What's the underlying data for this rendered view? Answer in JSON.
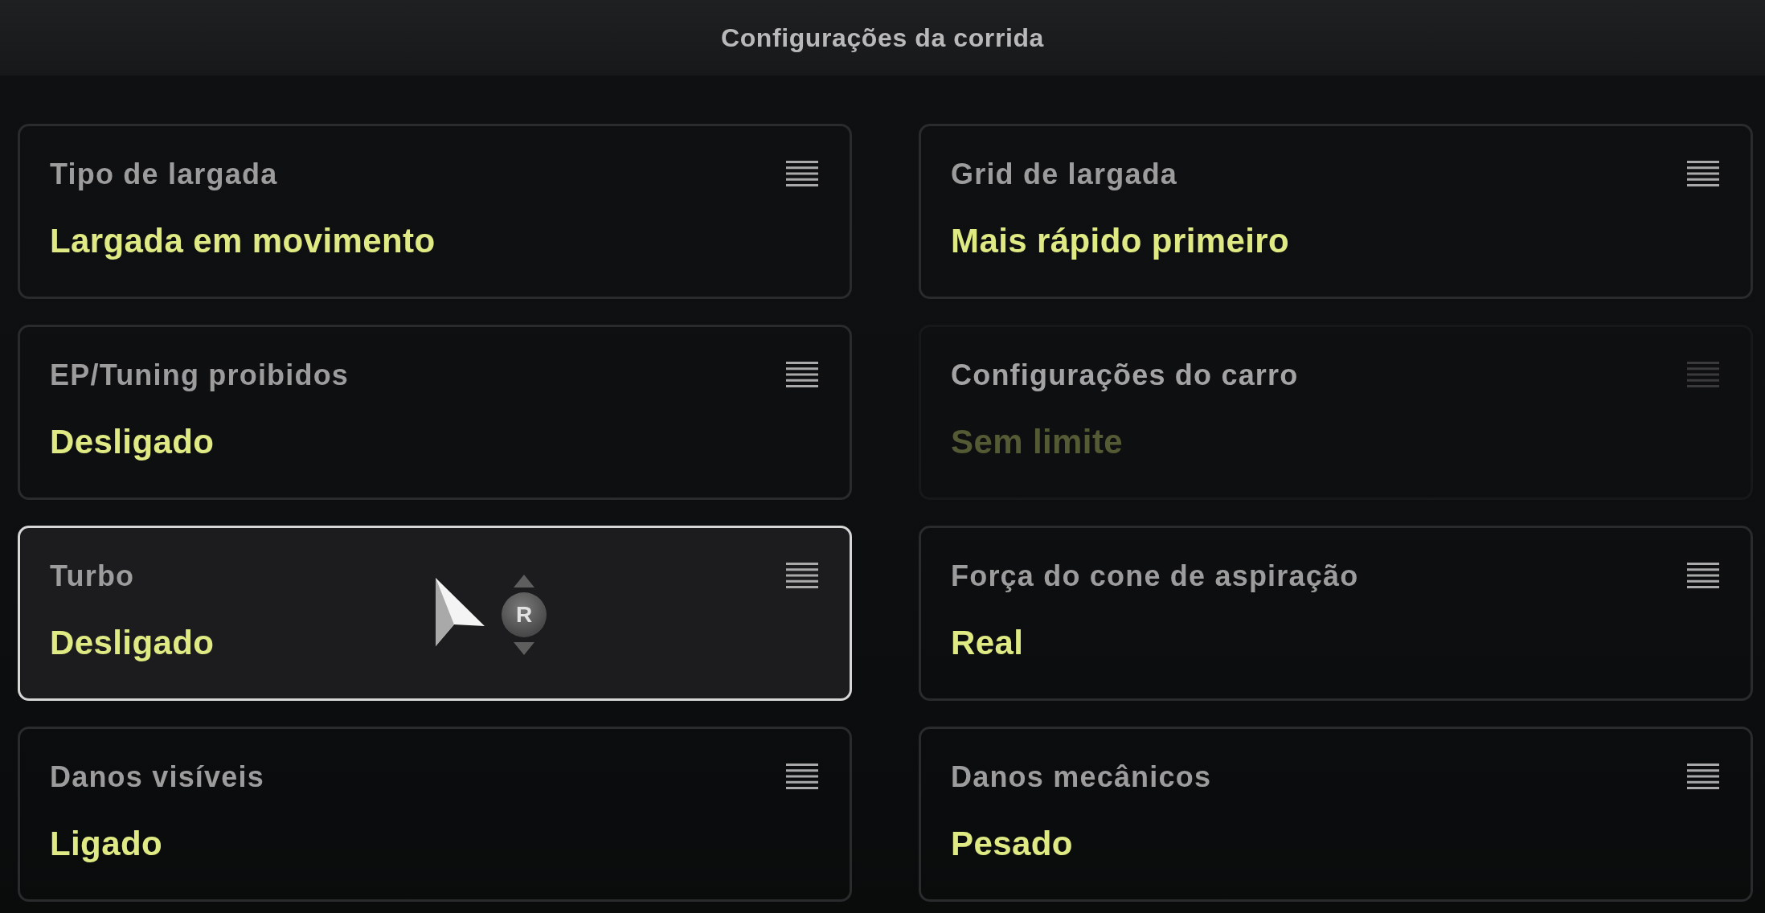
{
  "header": {
    "title": "Configurações da corrida"
  },
  "settings": [
    {
      "label": "Tipo de largada",
      "value": "Largada em movimento",
      "selected": false,
      "disabled": false
    },
    {
      "label": "Grid de largada",
      "value": "Mais rápido primeiro",
      "selected": false,
      "disabled": false
    },
    {
      "label": "EP/Tuning proibidos",
      "value": "Desligado",
      "selected": false,
      "disabled": false
    },
    {
      "label": "Configurações do carro",
      "value": "Sem limite",
      "selected": false,
      "disabled": true
    },
    {
      "label": "Turbo",
      "value": "Desligado",
      "selected": true,
      "disabled": false
    },
    {
      "label": "Força do cone de aspiração",
      "value": "Real",
      "selected": false,
      "disabled": false
    },
    {
      "label": "Danos visíveis",
      "value": "Ligado",
      "selected": false,
      "disabled": false
    },
    {
      "label": "Danos mecânicos",
      "value": "Pesado",
      "selected": false,
      "disabled": false
    }
  ],
  "cursor": {
    "button_label": "R"
  }
}
